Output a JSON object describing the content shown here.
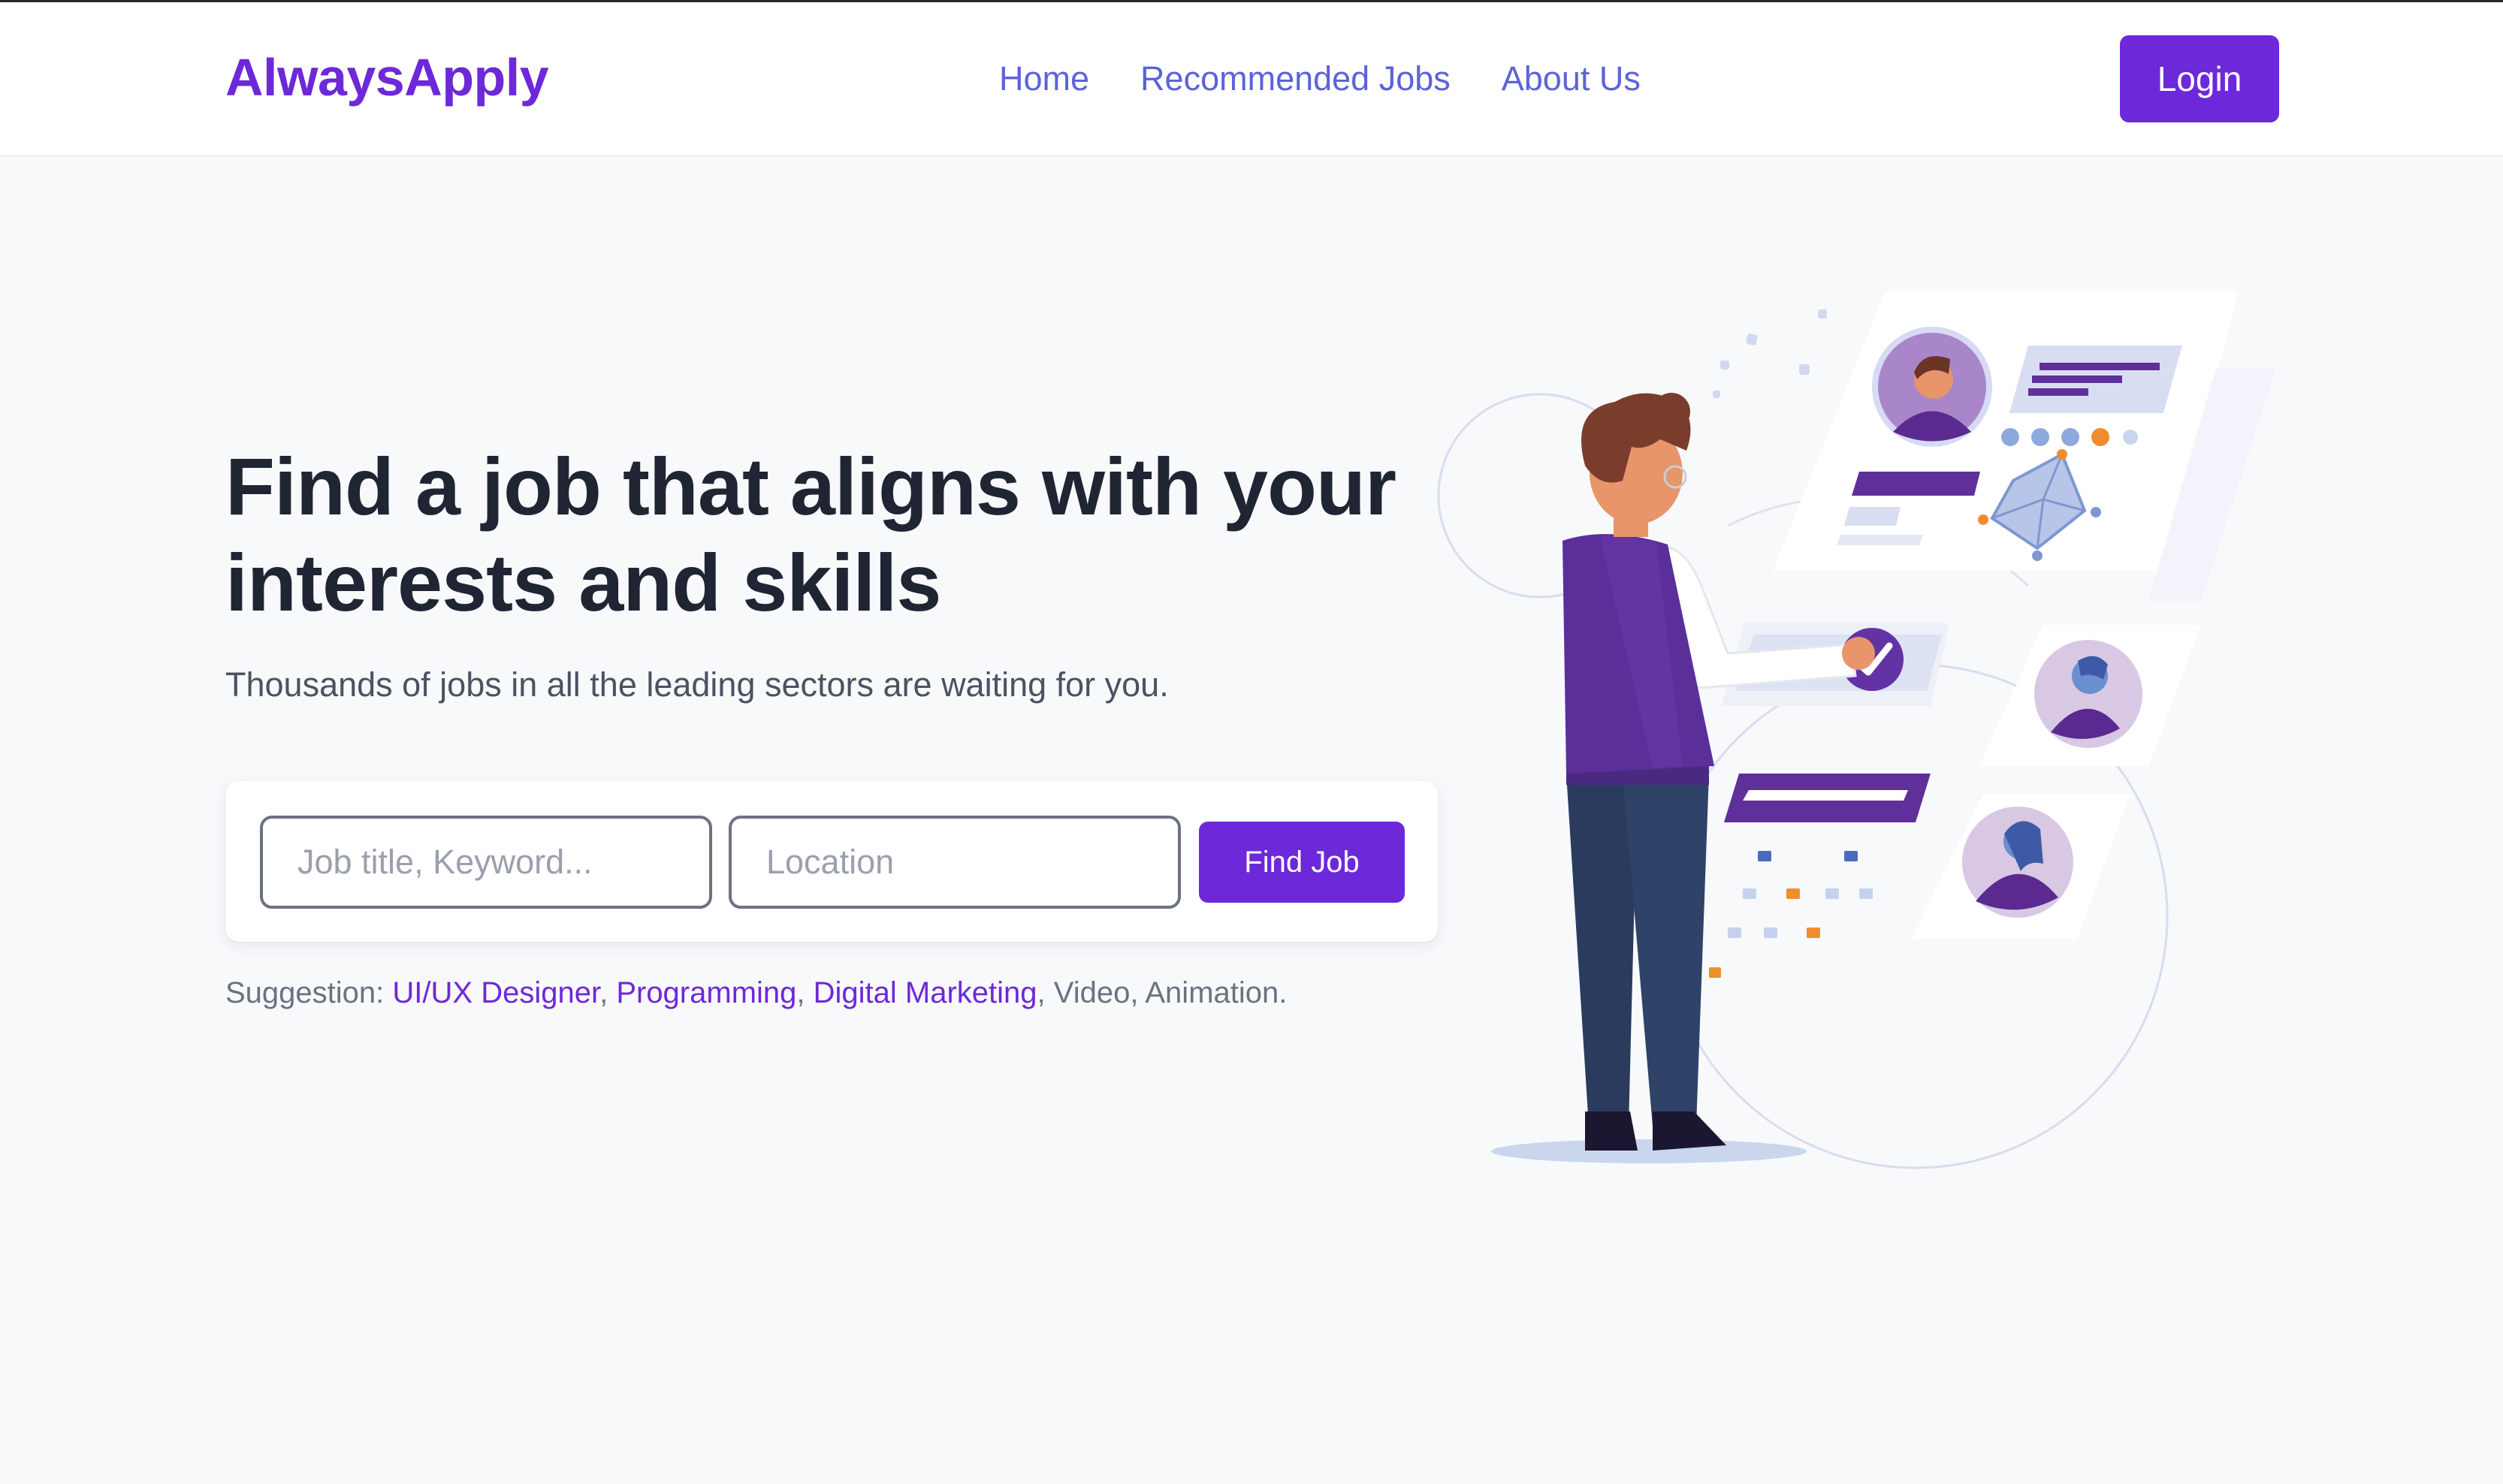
{
  "navbar": {
    "brand": "AlwaysApply",
    "links": [
      "Home",
      "Recommended Jobs",
      "About Us"
    ],
    "login_label": "Login"
  },
  "hero": {
    "headline": "Find a job that aligns with your interests and skills",
    "subline": "Thousands of jobs in all the leading sectors are waiting for you."
  },
  "search": {
    "job_placeholder": "Job title, Keyword...",
    "location_placeholder": "Location",
    "button_label": "Find Job"
  },
  "suggestions": {
    "prefix": "Suggestion:",
    "linked": [
      "UI/UX Designer",
      "Programming",
      "Digital Marketing"
    ],
    "plain": [
      "Video",
      "Animation."
    ]
  },
  "colors": {
    "brand": "#6d28d9",
    "nav_link": "#5b63d9",
    "headline": "#1f2533",
    "background": "#f8f9fb"
  },
  "icons": [
    "person-at-dashboard-illustration",
    "check-icon",
    "avatar-icon"
  ]
}
